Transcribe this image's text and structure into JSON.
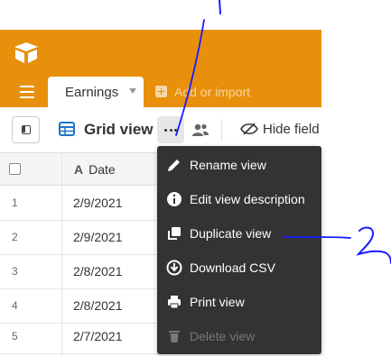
{
  "header": {
    "tab_label": "Earnings",
    "add_import_label": "Add or import"
  },
  "toolbar": {
    "view_name": "Grid view",
    "hide_fields_label": "Hide field"
  },
  "grid": {
    "column_header": "Date",
    "rows": [
      {
        "num": "1",
        "date": "2/9/2021"
      },
      {
        "num": "2",
        "date": "2/9/2021"
      },
      {
        "num": "3",
        "date": "2/8/2021"
      },
      {
        "num": "4",
        "date": "2/8/2021"
      },
      {
        "num": "5",
        "date": "2/7/2021"
      }
    ]
  },
  "menu": {
    "items": [
      {
        "label": "Rename view",
        "icon": "pencil-icon",
        "disabled": false
      },
      {
        "label": "Edit view description",
        "icon": "info-icon",
        "disabled": false
      },
      {
        "label": "Duplicate view",
        "icon": "duplicate-icon",
        "disabled": false
      },
      {
        "label": "Download CSV",
        "icon": "download-icon",
        "disabled": false
      },
      {
        "label": "Print view",
        "icon": "printer-icon",
        "disabled": false
      },
      {
        "label": "Delete view",
        "icon": "trash-icon",
        "disabled": true
      }
    ]
  },
  "annotations": {
    "mark_1": "1",
    "mark_2": "2"
  },
  "colors": {
    "header_bg": "#e8900c",
    "menu_bg": "#333333",
    "annotation_ink": "#1a1aff"
  }
}
